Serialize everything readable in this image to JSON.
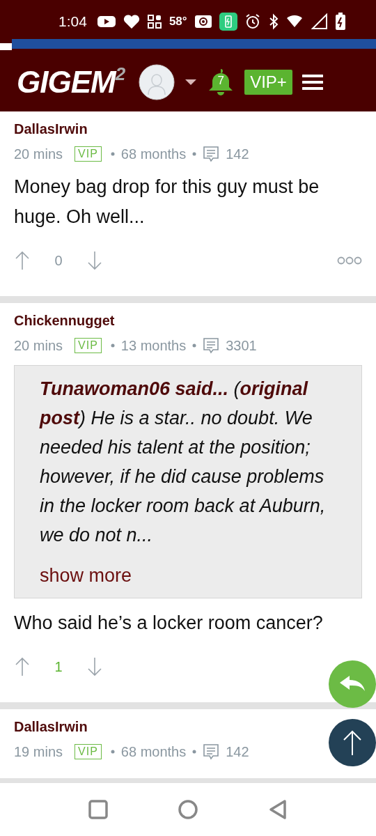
{
  "status_bar": {
    "time": "1:04",
    "temperature": "58°"
  },
  "header": {
    "logo": "GIGEM",
    "logo_sup": "2",
    "notifications": "7",
    "vip_button": "VIP+"
  },
  "posts": [
    {
      "username": "DallasIrwin",
      "time": "20 mins",
      "badge": "VIP",
      "tenure": "68 months",
      "post_count": "142",
      "body": "Money bag drop for this guy must be huge. Oh well...",
      "score": "0",
      "positive": false
    },
    {
      "username": "Chickennugget",
      "time": "20 mins",
      "badge": "VIP",
      "tenure": "13 months",
      "post_count": "3301",
      "quote": "**Tunawoman06 said...** (**original post**) He is a star.. no doubt. We needed his talent at the position; however, if he did cause problems in the locker room back at Auburn, we do not n...",
      "show_more": "show more",
      "body": "Who said he’s a locker room cancer?",
      "score": "1",
      "positive": true
    },
    {
      "username": "DallasIrwin",
      "time": "19 mins",
      "badge": "VIP",
      "tenure": "68 months",
      "post_count": "142"
    }
  ]
}
